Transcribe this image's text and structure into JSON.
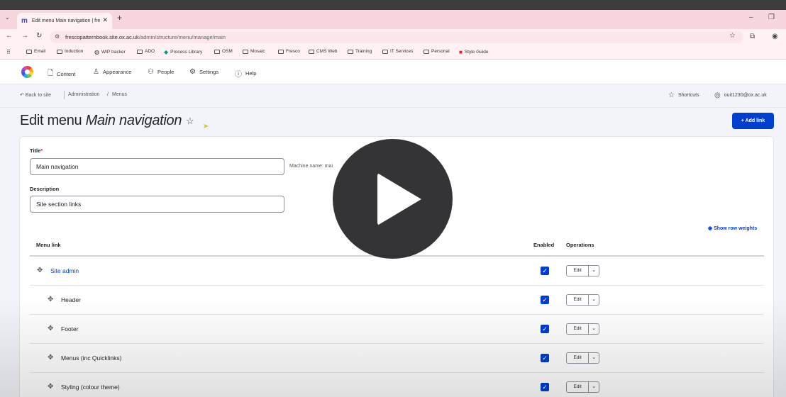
{
  "browser": {
    "tab_title": "Edit menu Main navigation | fre",
    "new_tab_label": "+",
    "url_host": "frescopatternbook.site.ox.ac.uk",
    "url_path": "/admin/structure/menu/manage/main",
    "bookmarks": [
      "Email",
      "Induction",
      "WIP tracker",
      "ADO",
      "Process Library",
      "OSM",
      "Mosaic",
      "Fresco",
      "CMS Web",
      "Training",
      "IT Services",
      "Personal",
      "Style Guide"
    ]
  },
  "toolbar": {
    "items": [
      "Content",
      "Appearance",
      "People",
      "Settings",
      "Help"
    ]
  },
  "breadcrumb": {
    "back": "Back to site",
    "items": [
      "Administration",
      "Menus"
    ],
    "shortcuts": "Shortcuts",
    "user": "ouit1230@ox.ac.uk"
  },
  "page": {
    "title_prefix": "Edit menu ",
    "title_name": "Main navigation",
    "add_link": "+ Add link"
  },
  "form": {
    "title_label": "Title",
    "title_required": "*",
    "title_value": "Main navigation",
    "machine_name": "Machine name: mai",
    "description_label": "Description",
    "description_value": "Site section links",
    "show_row_weights": "Show row weights"
  },
  "table": {
    "columns": [
      "Menu link",
      "Enabled",
      "Operations"
    ],
    "rows": [
      {
        "label": "Site admin",
        "enabled": true,
        "op": "Edit"
      },
      {
        "label": "Header",
        "enabled": true,
        "op": "Edit"
      },
      {
        "label": "Footer",
        "enabled": true,
        "op": "Edit"
      },
      {
        "label": "Menus (inc Quicklinks)",
        "enabled": true,
        "op": "Edit"
      },
      {
        "label": "Styling (colour theme)",
        "enabled": true,
        "op": "Edit"
      }
    ]
  },
  "colors": {
    "accent": "#003ecc",
    "tabbar": "#f8d6dd",
    "page_bg": "#f3f4f9"
  }
}
